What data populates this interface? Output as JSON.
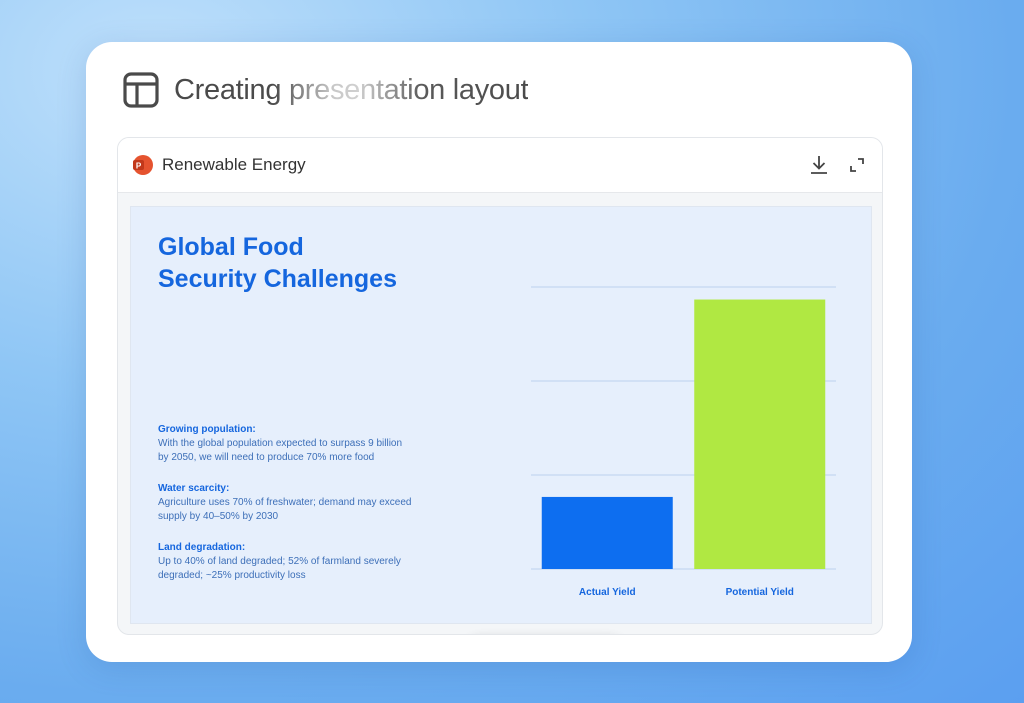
{
  "header": {
    "title": "Creating presentation layout",
    "icon": "layout-grid-icon"
  },
  "viewer": {
    "file_name": "Renewable Energy",
    "file_icon": "powerpoint-icon",
    "actions": [
      "download-icon",
      "fullscreen-icon"
    ]
  },
  "slide": {
    "title_line1": "Global Food",
    "title_line2": "Security Challenges",
    "points": [
      {
        "heading": "Growing population:",
        "line1": "With the global population expected to surpass 9 billion",
        "line2": "by 2050, we will need to produce 70% more food"
      },
      {
        "heading": "Water scarcity:",
        "line1": "Agriculture uses 70% of freshwater; demand may exceed",
        "line2": "supply by 40–50% by 2030"
      },
      {
        "heading": "Land degradation:",
        "line1": "Up to 40% of land degraded; 52% of farmland severely",
        "line2": "degraded; ~25% productivity loss"
      }
    ]
  },
  "chart_data": {
    "type": "bar",
    "categories": [
      "Actual Yield",
      "Potential Yield"
    ],
    "values": [
      23,
      86
    ],
    "ylim": [
      0,
      90
    ],
    "grid": true,
    "colors": [
      "#0d6ef0",
      "#b0e842"
    ]
  },
  "controls": {
    "prev": "chevron-left-icon",
    "play": "play-icon",
    "next": "chevron-right-icon"
  },
  "colors": {
    "accent": "#1566de",
    "slide_bg": "#e6effc"
  }
}
